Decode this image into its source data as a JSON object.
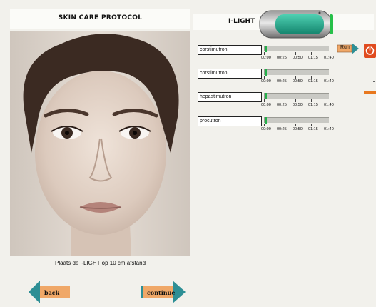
{
  "left_panel": {
    "title": "SKIN CARE PROTOCOL",
    "instruction": "Plaats de i-LIGHT op 10 cm afstand"
  },
  "right_panel": {
    "title": "I-LIGHT",
    "device_icon": "i-light-device-icon"
  },
  "timeline_labels": [
    "00:00",
    "00:25",
    "00:50",
    "01:15",
    "01:40"
  ],
  "programs": [
    {
      "name": "corstimutron",
      "progress_fraction": 0.0
    },
    {
      "name": "corstimutron",
      "progress_fraction": 0.0
    },
    {
      "name": "hepastimutron",
      "progress_fraction": 0.0
    },
    {
      "name": "procutron",
      "progress_fraction": 0.0
    }
  ],
  "buttons": {
    "run": "Run",
    "back": "back",
    "continue": "continue"
  },
  "icons": {
    "power": "power-icon"
  },
  "colors": {
    "accent_teal": "#1fa389",
    "button_orange": "#f0a868",
    "power_red": "#e04b1f",
    "progress_green": "#25b04a"
  }
}
